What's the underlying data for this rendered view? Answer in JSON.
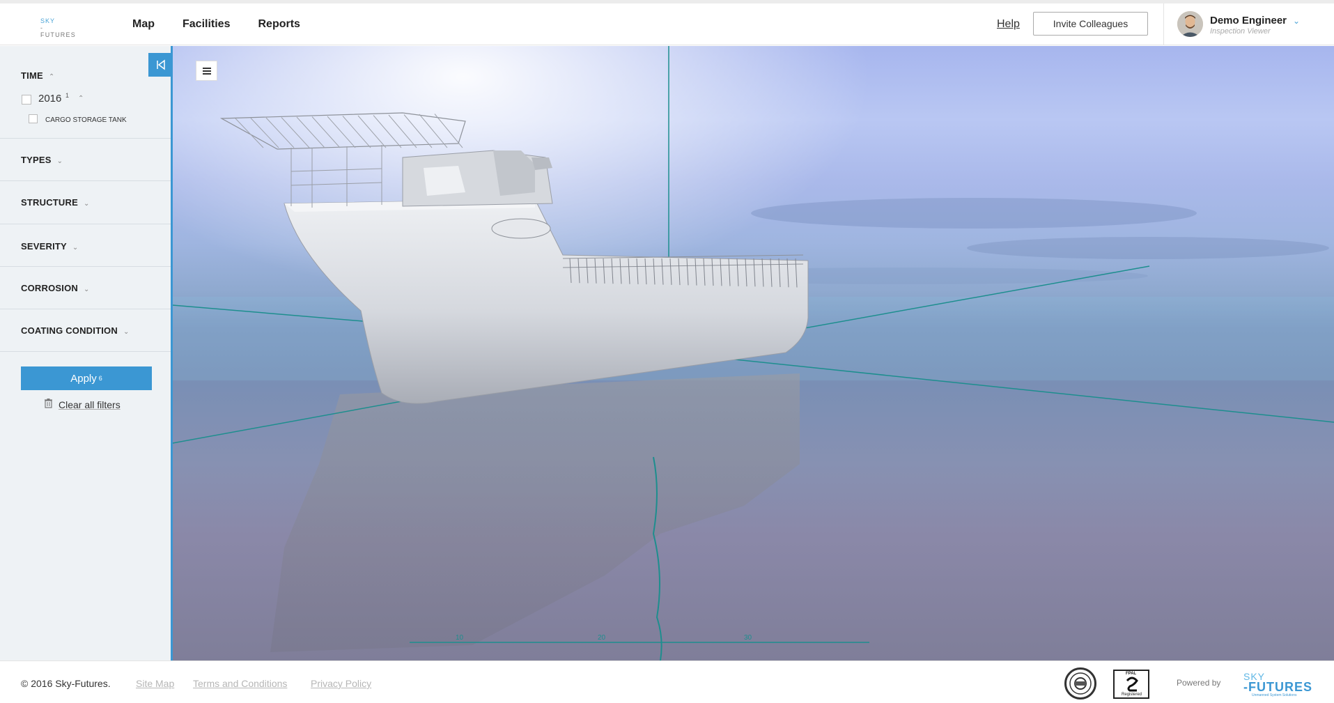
{
  "header": {
    "logo_top": "SKY",
    "logo_bottom": "-FUTURES",
    "nav": [
      "Map",
      "Facilities",
      "Reports"
    ],
    "help_label": "Help",
    "invite_label": "Invite Colleagues",
    "user_name": "Demo Engineer",
    "user_role": "Inspection Viewer",
    "user_chevron": "chevron-down-icon"
  },
  "sidebar": {
    "collapse_icon": "collapse-left-icon",
    "time": {
      "title": "TIME",
      "year": "2016",
      "year_count": "1",
      "asset": "CARGO STORAGE TANK"
    },
    "filters": [
      "TYPES",
      "STRUCTURE",
      "SEVERITY",
      "CORROSION",
      "COATING CONDITION"
    ],
    "apply_label": "Apply",
    "apply_count": "6",
    "clear_label": "Clear all filters"
  },
  "viewport": {
    "menu_icon": "hamburger-icon",
    "scale_labels": [
      "10",
      "20",
      "30"
    ]
  },
  "footer": {
    "copyright": "© 2016 Sky-Futures.",
    "links": [
      "Site Map",
      "Terms and Conditions",
      "Privacy Policy"
    ],
    "powered_by": "Powered by",
    "logo_top": "SKY",
    "logo_bottom": "-FUTURES",
    "logo_tagline": "Unmanned System Solutions",
    "fpal_top": "FPAL",
    "fpal_bottom": "Registered"
  },
  "colors": {
    "accent": "#3b97d3",
    "sidebar_bg": "#eef2f5",
    "axis_teal": "#1d8e8e"
  }
}
